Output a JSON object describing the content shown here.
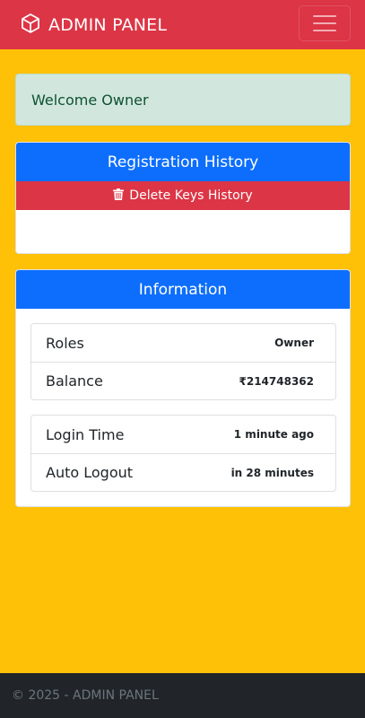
{
  "navbar": {
    "brand_icon": "cube-icon",
    "brand_text": "ADMIN PANEL",
    "menu_icon": "hamburger-menu-icon",
    "color": "#dc3545"
  },
  "alert": {
    "text": "Welcome Owner",
    "color": "#d1e7dd"
  },
  "registration": {
    "header": "Registration History",
    "delete_icon": "trash-icon",
    "delete_label": "Delete Keys History"
  },
  "information": {
    "header": "Information",
    "group1": [
      {
        "label": "Roles",
        "value": "Owner"
      },
      {
        "label": "Balance",
        "value": "₹214748362"
      }
    ],
    "group2": [
      {
        "label": "Login Time",
        "value": "1 minute ago"
      },
      {
        "label": "Auto Logout",
        "value": "in 28 minutes"
      }
    ]
  },
  "footer": {
    "text": "© 2025 - ADMIN PANEL"
  },
  "colors": {
    "background": "#ffc107",
    "primary": "#0d6efd",
    "danger": "#dc3545",
    "footer": "#212529"
  }
}
